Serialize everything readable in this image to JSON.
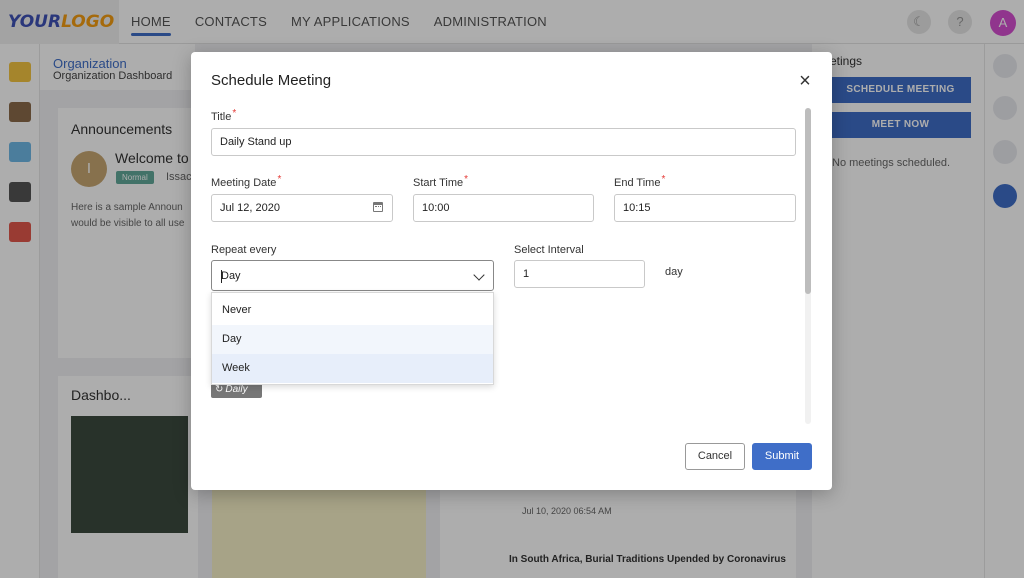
{
  "app": {
    "logo": {
      "part1": "YOUR",
      "part2": "LOGO"
    },
    "nav": [
      "HOME",
      "CONTACTS",
      "MY APPLICATIONS",
      "ADMINISTRATION"
    ],
    "avatar_initial": "A",
    "theme_icon": "moon-icon",
    "help_label": "?"
  },
  "organization": {
    "title": "Organization",
    "subtitle": "Organization Dashboard"
  },
  "announcements": {
    "title": "Announcements",
    "avatar_initial": "I",
    "heading": "Welcome to",
    "badge": "Normal",
    "author": "Issac",
    "body_line1": "Here is a sample Announ",
    "body_line2": "would be visible to all use"
  },
  "dashboard_card": {
    "title": "Dashbo..."
  },
  "meetings": {
    "title": "etings",
    "schedule_btn": "SCHEDULE MEETING",
    "meet_now_btn": "MEET NOW",
    "empty": "No meetings scheduled."
  },
  "news": {
    "date": "Jul 10, 2020 06:54 AM",
    "title": "In South Africa, Burial Traditions Upended by Coronavirus"
  },
  "modal": {
    "title": "Schedule Meeting",
    "close_symbol": "×",
    "title_label": "Title",
    "title_value": "Daily Stand up",
    "date_label": "Meeting Date",
    "date_value": "Jul 12, 2020",
    "start_label": "Start Time",
    "start_value": "10:00",
    "end_label": "End Time",
    "end_value": "10:15",
    "repeat_label": "Repeat every",
    "repeat_value": "Day",
    "repeat_options": [
      "Never",
      "Day",
      "Week"
    ],
    "interval_label": "Select Interval",
    "interval_value": "1",
    "interval_unit": "day",
    "chip_symbol": "↻",
    "chip_label": "Daily",
    "cancel_label": "Cancel",
    "submit_label": "Submit",
    "required_mark": "*"
  }
}
